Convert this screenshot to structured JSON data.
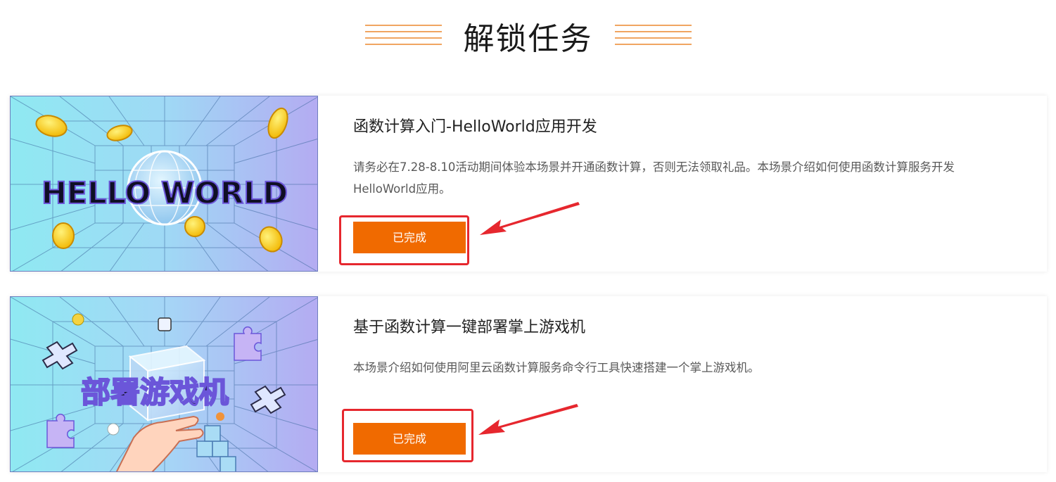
{
  "page": {
    "title": "解锁任务"
  },
  "tasks": [
    {
      "title": "函数计算入门-HelloWorld应用开发",
      "description": "请务必在7.28-8.10活动期间体验本场景并开通函数计算，否则无法领取礼品。本场景介绍如何使用函数计算服务开发HelloWorld应用。",
      "thumb_text": "HELLO WORLD",
      "button_label": "已完成"
    },
    {
      "title": "基于函数计算一键部署掌上游戏机",
      "description": "本场景介绍如何使用阿里云函数计算服务命令行工具快速搭建一个掌上游戏机。",
      "thumb_text": "部署游戏机",
      "button_label": "已完成"
    }
  ],
  "colors": {
    "accent": "#f06a00",
    "highlight": "#e6272e",
    "decoration": "#f0a561"
  }
}
